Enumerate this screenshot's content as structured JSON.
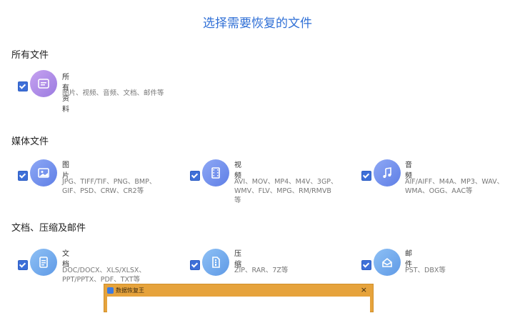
{
  "page": {
    "title": "选择需要恢复的文件"
  },
  "sections": {
    "all": {
      "label": "所有文件"
    },
    "media": {
      "label": "媒体文件"
    },
    "docs": {
      "label": "文档、压缩及邮件"
    }
  },
  "items": {
    "all_data": {
      "name": "所有资料",
      "desc": "图片、视频、音频、文档、邮件等",
      "checked": true,
      "icon": "all-files-icon",
      "color": "#b48ee6"
    },
    "pictures": {
      "name": "图片",
      "desc": "JPG、TIFF/TIF、PNG、BMP、GIF、PSD、CRW、CR2等",
      "checked": true,
      "icon": "image-icon",
      "color": "#6f8ff0"
    },
    "video": {
      "name": "视频",
      "desc": "AVI、MOV、MP4、M4V、3GP、WMV、FLV、MPG、RM/RMVB等",
      "checked": true,
      "icon": "film-icon",
      "color": "#6f8ff0"
    },
    "audio": {
      "name": "音频",
      "desc": "AIF/AIFF、M4A、MP3、WAV、WMA、OGG、AAC等",
      "checked": true,
      "icon": "music-note-icon",
      "color": "#6f8ff0"
    },
    "documents": {
      "name": "文档",
      "desc": "DOC/DOCX、XLS/XLSX、PPT/PPTX、PDF、TXT等",
      "checked": true,
      "icon": "document-icon",
      "color": "#6fa8f0"
    },
    "archive": {
      "name": "压缩",
      "desc": "ZIP、RAR、7Z等",
      "checked": true,
      "icon": "archive-icon",
      "color": "#6fa8f0"
    },
    "mail": {
      "name": "邮件",
      "desc": "PST、DBX等",
      "checked": true,
      "icon": "mail-icon",
      "color": "#6fa8f0"
    }
  },
  "dialog": {
    "title": "数据恢复王",
    "close": "×"
  }
}
